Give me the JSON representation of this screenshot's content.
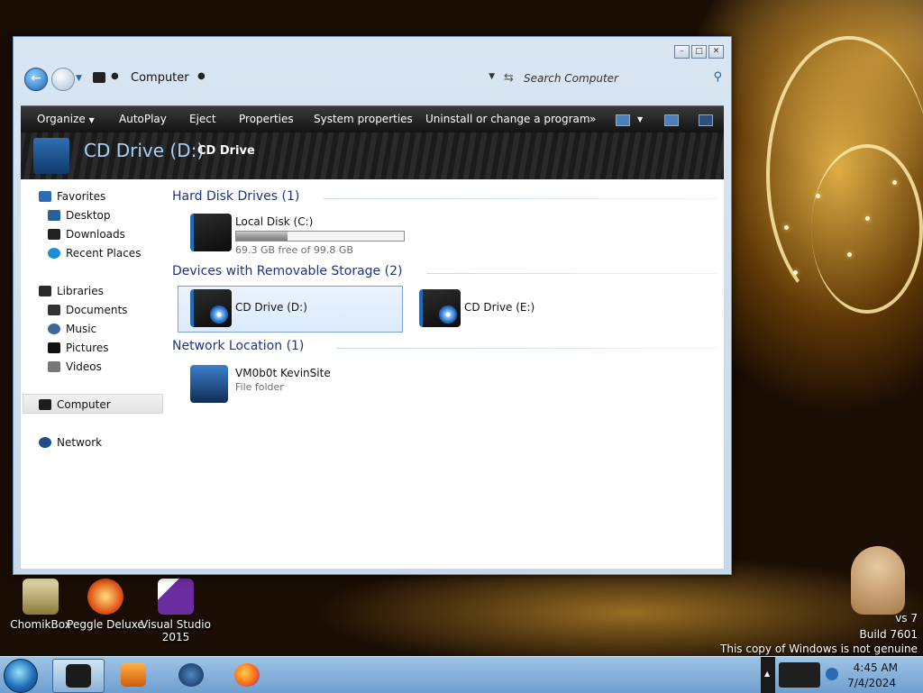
{
  "desktop": {
    "icons": [
      {
        "label": "ChomikBox"
      },
      {
        "label": "Peggle Deluxe"
      },
      {
        "label": "Visual Studio 2015"
      }
    ],
    "watermark": {
      "line1": "vs 7",
      "line2": "Build 7601",
      "line3": "This copy of Windows is not genuine"
    }
  },
  "window": {
    "address": {
      "location": "Computer"
    },
    "search": {
      "placeholder": "Search Computer"
    },
    "toolbar": {
      "items": [
        "Organize",
        "AutoPlay",
        "Eject",
        "Properties",
        "System properties",
        "Uninstall or change a program"
      ],
      "more": "»"
    },
    "header": {
      "title": "CD Drive (D:)",
      "subtitle": "CD Drive"
    },
    "nav": {
      "favorites": "Favorites",
      "desktop": "Desktop",
      "downloads": "Downloads",
      "recent": "Recent Places",
      "libraries": "Libraries",
      "documents": "Documents",
      "music": "Music",
      "pictures": "Pictures",
      "videos": "Videos",
      "computer": "Computer",
      "network": "Network"
    },
    "groups": {
      "hdd": "Hard Disk Drives (1)",
      "removable": "Devices with Removable Storage (2)",
      "network": "Network Location (1)"
    },
    "drives": {
      "c": {
        "name": "Local Disk (C:)",
        "free": "69.3 GB free of 99.8 GB",
        "used_fraction": 0.305
      },
      "d": {
        "name": "CD Drive (D:)"
      },
      "e": {
        "name": "CD Drive (E:)"
      },
      "net": {
        "name": "VM0b0t KevinSite",
        "type": "File folder"
      }
    }
  },
  "taskbar": {
    "time": "4:45 AM",
    "date": "7/4/2024"
  },
  "colors": {
    "group_header": "#1e3287",
    "header_title": "#a7d0f6",
    "taskbar": "#8db6df"
  }
}
